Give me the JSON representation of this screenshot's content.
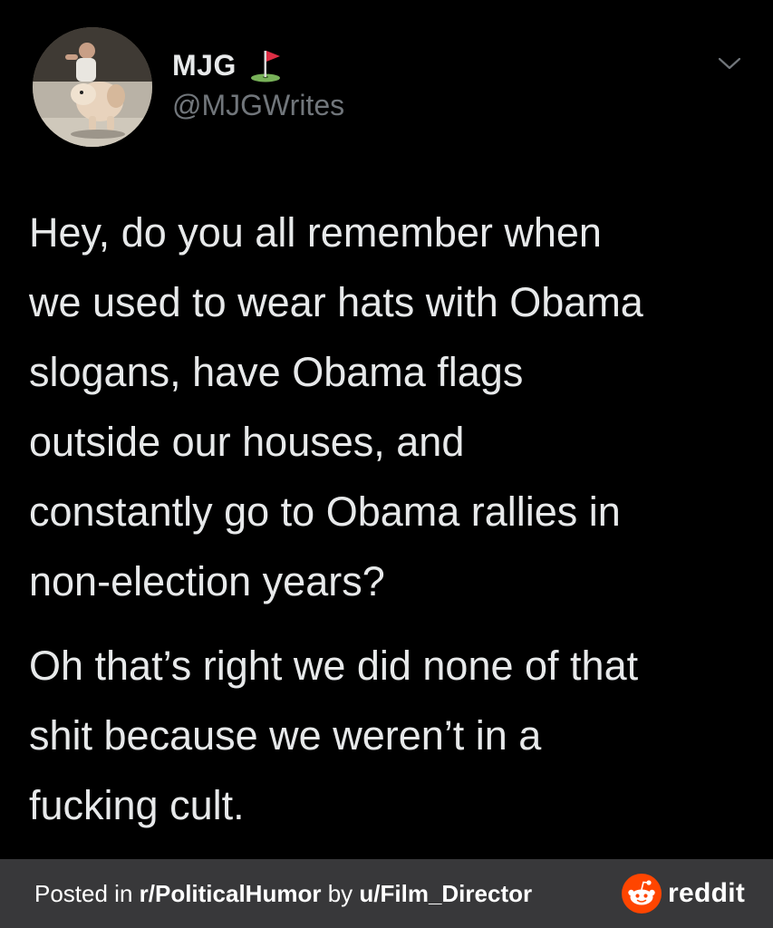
{
  "tweet": {
    "avatar_icon": "profile-photo-man-with-dog",
    "display_name": "MJG",
    "name_emoji_icon": "golf-flag-icon",
    "handle": "@MJGWrites",
    "menu_icon": "chevron-down-icon",
    "paragraph_1_lines": [
      "Hey, do you all remember when",
      "we used to wear hats with Obama",
      "slogans, have Obama flags",
      "outside our houses, and",
      "constantly go to Obama rallies in",
      "non-election years?"
    ],
    "paragraph_2_lines": [
      "Oh that’s right we did none of that",
      "shit because we weren’t in a",
      "fucking cult."
    ]
  },
  "footer": {
    "posted_in": "Posted in ",
    "subreddit": "r/PoliticalHumor",
    "by": " by ",
    "user": "u/Film_Director",
    "brand_icon": "reddit-snoo-icon",
    "brand": "reddit",
    "brand_color": "#ff4500"
  },
  "colors": {
    "background": "#000000",
    "text": "#e7e9ea",
    "handle": "#71767b",
    "footer_bg": "#38383a"
  }
}
